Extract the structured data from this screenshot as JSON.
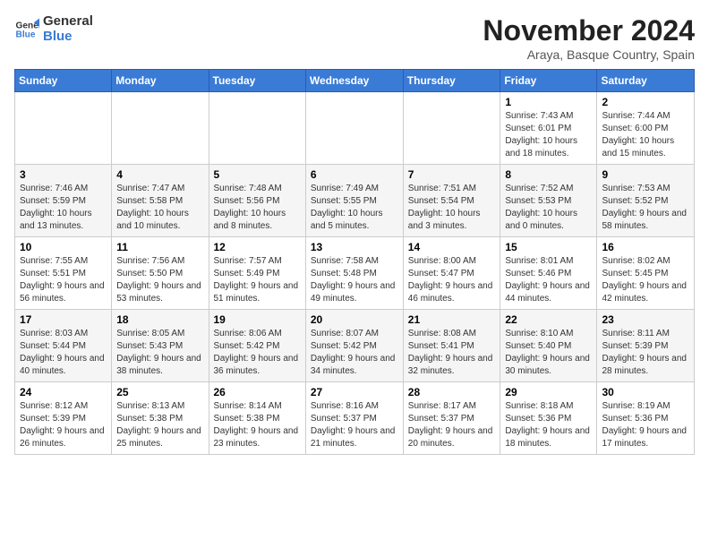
{
  "logo": {
    "line1": "General",
    "line2": "Blue"
  },
  "title": "November 2024",
  "subtitle": "Araya, Basque Country, Spain",
  "weekdays": [
    "Sunday",
    "Monday",
    "Tuesday",
    "Wednesday",
    "Thursday",
    "Friday",
    "Saturday"
  ],
  "rows": [
    [
      {
        "day": "",
        "info": ""
      },
      {
        "day": "",
        "info": ""
      },
      {
        "day": "",
        "info": ""
      },
      {
        "day": "",
        "info": ""
      },
      {
        "day": "",
        "info": ""
      },
      {
        "day": "1",
        "info": "Sunrise: 7:43 AM\nSunset: 6:01 PM\nDaylight: 10 hours and 18 minutes."
      },
      {
        "day": "2",
        "info": "Sunrise: 7:44 AM\nSunset: 6:00 PM\nDaylight: 10 hours and 15 minutes."
      }
    ],
    [
      {
        "day": "3",
        "info": "Sunrise: 7:46 AM\nSunset: 5:59 PM\nDaylight: 10 hours and 13 minutes."
      },
      {
        "day": "4",
        "info": "Sunrise: 7:47 AM\nSunset: 5:58 PM\nDaylight: 10 hours and 10 minutes."
      },
      {
        "day": "5",
        "info": "Sunrise: 7:48 AM\nSunset: 5:56 PM\nDaylight: 10 hours and 8 minutes."
      },
      {
        "day": "6",
        "info": "Sunrise: 7:49 AM\nSunset: 5:55 PM\nDaylight: 10 hours and 5 minutes."
      },
      {
        "day": "7",
        "info": "Sunrise: 7:51 AM\nSunset: 5:54 PM\nDaylight: 10 hours and 3 minutes."
      },
      {
        "day": "8",
        "info": "Sunrise: 7:52 AM\nSunset: 5:53 PM\nDaylight: 10 hours and 0 minutes."
      },
      {
        "day": "9",
        "info": "Sunrise: 7:53 AM\nSunset: 5:52 PM\nDaylight: 9 hours and 58 minutes."
      }
    ],
    [
      {
        "day": "10",
        "info": "Sunrise: 7:55 AM\nSunset: 5:51 PM\nDaylight: 9 hours and 56 minutes."
      },
      {
        "day": "11",
        "info": "Sunrise: 7:56 AM\nSunset: 5:50 PM\nDaylight: 9 hours and 53 minutes."
      },
      {
        "day": "12",
        "info": "Sunrise: 7:57 AM\nSunset: 5:49 PM\nDaylight: 9 hours and 51 minutes."
      },
      {
        "day": "13",
        "info": "Sunrise: 7:58 AM\nSunset: 5:48 PM\nDaylight: 9 hours and 49 minutes."
      },
      {
        "day": "14",
        "info": "Sunrise: 8:00 AM\nSunset: 5:47 PM\nDaylight: 9 hours and 46 minutes."
      },
      {
        "day": "15",
        "info": "Sunrise: 8:01 AM\nSunset: 5:46 PM\nDaylight: 9 hours and 44 minutes."
      },
      {
        "day": "16",
        "info": "Sunrise: 8:02 AM\nSunset: 5:45 PM\nDaylight: 9 hours and 42 minutes."
      }
    ],
    [
      {
        "day": "17",
        "info": "Sunrise: 8:03 AM\nSunset: 5:44 PM\nDaylight: 9 hours and 40 minutes."
      },
      {
        "day": "18",
        "info": "Sunrise: 8:05 AM\nSunset: 5:43 PM\nDaylight: 9 hours and 38 minutes."
      },
      {
        "day": "19",
        "info": "Sunrise: 8:06 AM\nSunset: 5:42 PM\nDaylight: 9 hours and 36 minutes."
      },
      {
        "day": "20",
        "info": "Sunrise: 8:07 AM\nSunset: 5:42 PM\nDaylight: 9 hours and 34 minutes."
      },
      {
        "day": "21",
        "info": "Sunrise: 8:08 AM\nSunset: 5:41 PM\nDaylight: 9 hours and 32 minutes."
      },
      {
        "day": "22",
        "info": "Sunrise: 8:10 AM\nSunset: 5:40 PM\nDaylight: 9 hours and 30 minutes."
      },
      {
        "day": "23",
        "info": "Sunrise: 8:11 AM\nSunset: 5:39 PM\nDaylight: 9 hours and 28 minutes."
      }
    ],
    [
      {
        "day": "24",
        "info": "Sunrise: 8:12 AM\nSunset: 5:39 PM\nDaylight: 9 hours and 26 minutes."
      },
      {
        "day": "25",
        "info": "Sunrise: 8:13 AM\nSunset: 5:38 PM\nDaylight: 9 hours and 25 minutes."
      },
      {
        "day": "26",
        "info": "Sunrise: 8:14 AM\nSunset: 5:38 PM\nDaylight: 9 hours and 23 minutes."
      },
      {
        "day": "27",
        "info": "Sunrise: 8:16 AM\nSunset: 5:37 PM\nDaylight: 9 hours and 21 minutes."
      },
      {
        "day": "28",
        "info": "Sunrise: 8:17 AM\nSunset: 5:37 PM\nDaylight: 9 hours and 20 minutes."
      },
      {
        "day": "29",
        "info": "Sunrise: 8:18 AM\nSunset: 5:36 PM\nDaylight: 9 hours and 18 minutes."
      },
      {
        "day": "30",
        "info": "Sunrise: 8:19 AM\nSunset: 5:36 PM\nDaylight: 9 hours and 17 minutes."
      }
    ]
  ]
}
